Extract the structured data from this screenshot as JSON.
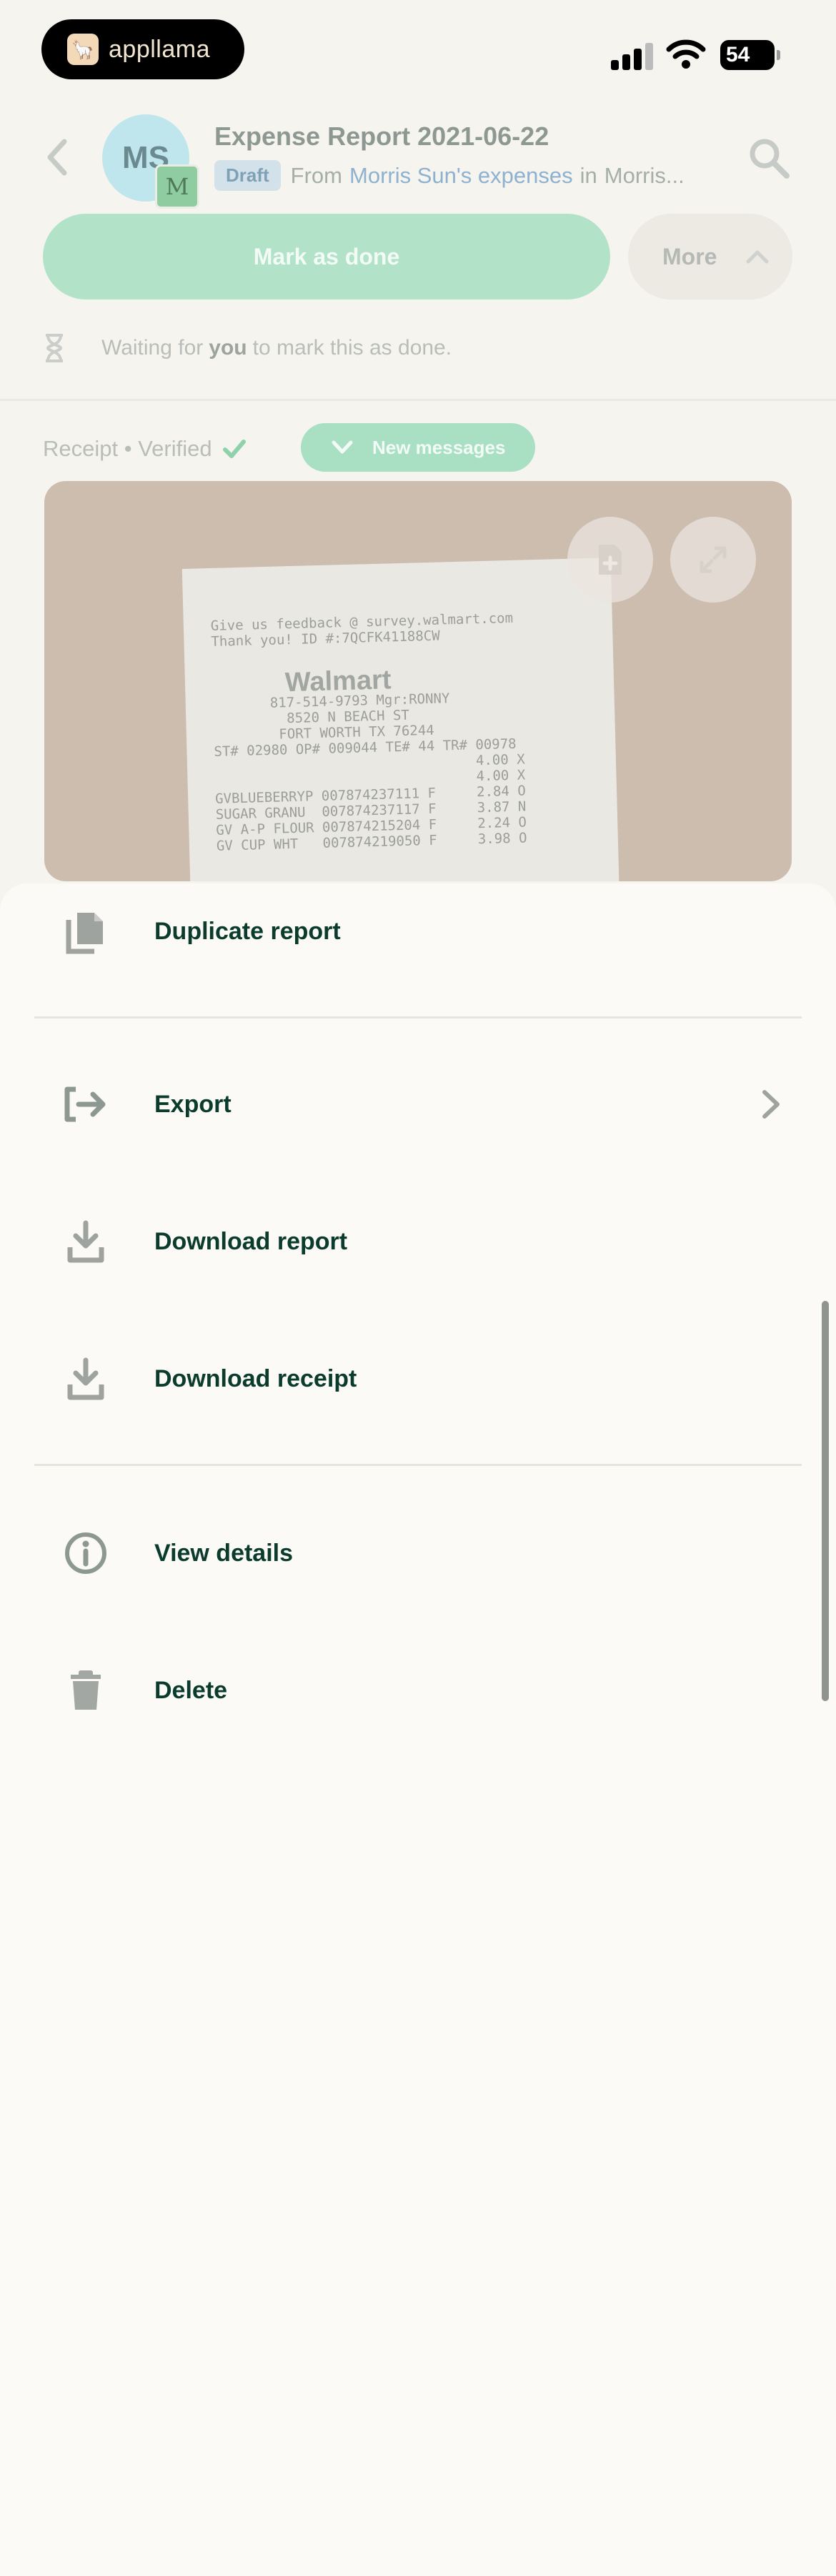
{
  "status_bar": {
    "app_brand": "appllama",
    "battery": "54"
  },
  "header": {
    "title": "Expense Report 2021-06-22",
    "avatar_initials": "MS",
    "sub_avatar_initial": "M",
    "draft_badge": "Draft",
    "from_prefix": "From",
    "from_link": "Morris Sun's expenses",
    "in_prefix": "in",
    "in_location": "Morris..."
  },
  "actions": {
    "mark_done": "Mark as done",
    "more": "More"
  },
  "waiting": {
    "before": "Waiting for",
    "emphasis": "you",
    "after": "to mark this as done."
  },
  "receipt": {
    "label": "Receipt • Verified",
    "new_messages": "New messages",
    "lines": "Give us feedback @ survey.walmart.com\nThank you! ID #:7QCFK41188CW\n\n\n\n       817-514-9793 Mgr:RONNY\n         8520 N BEACH ST\n        FORT WORTH TX 76244\nST# 02980 OP# 009044 TE# 44 TR# 00978\n                                4.00 X\n                                4.00 X\nGVBLUEBERRYP 007874237111 F     2.84 O\nSUGAR GRANU  007874237117 F     3.87 N\nGV A-P FLOUR 007874215204 F     2.24 O\nGV CUP WHT   007874219050 F     3.98 O",
    "brand_on_paper": "Walmart"
  },
  "menu": {
    "items": [
      {
        "label": "Duplicate report",
        "icon": "copy-icon"
      },
      {
        "label": "Export",
        "icon": "export-icon"
      },
      {
        "label": "Download report",
        "icon": "download-icon"
      },
      {
        "label": "Download receipt",
        "icon": "download-icon"
      },
      {
        "label": "View details",
        "icon": "info-icon"
      },
      {
        "label": "Delete",
        "icon": "trash-icon"
      }
    ]
  },
  "colors": {
    "primary_dark": "#0B3B2C",
    "accent_green": "#B2E3C8",
    "icon_gray": "#8E9893"
  }
}
